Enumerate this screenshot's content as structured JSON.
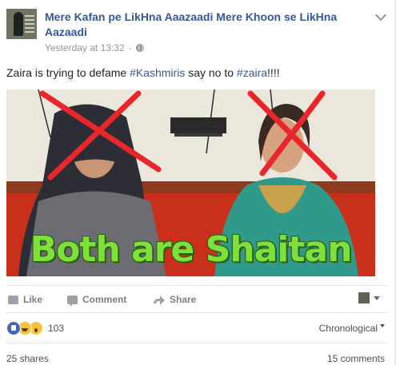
{
  "post": {
    "page_name": "Mere Kafan pe LikHna Aaazaadi Mere Khoon se LikHna Aazaadi",
    "timestamp": "Yesterday at 13:32",
    "separator": "·",
    "privacy_icon": "globe-icon",
    "text_prefix": "Zaira is trying to defame ",
    "hashtag1": "#Kashmiris",
    "text_middle": " say no to ",
    "hashtag2": "#zaira",
    "text_suffix": "!!!!",
    "image_caption": "Both are Shaitan"
  },
  "actions": {
    "like": "Like",
    "comment": "Comment",
    "share": "Share"
  },
  "reactions": {
    "count": "103",
    "icons": [
      "like-reaction-icon",
      "haha-reaction-icon",
      "wow-reaction-icon"
    ],
    "sort_label": "Chronological"
  },
  "footer": {
    "shares": "25 shares",
    "comments": "15 comments"
  },
  "colors": {
    "link": "#365899",
    "meta": "#90949c",
    "caption_green": "#7ee03a",
    "cross_red": "#e8262b",
    "like_blue": "#4267b2"
  }
}
